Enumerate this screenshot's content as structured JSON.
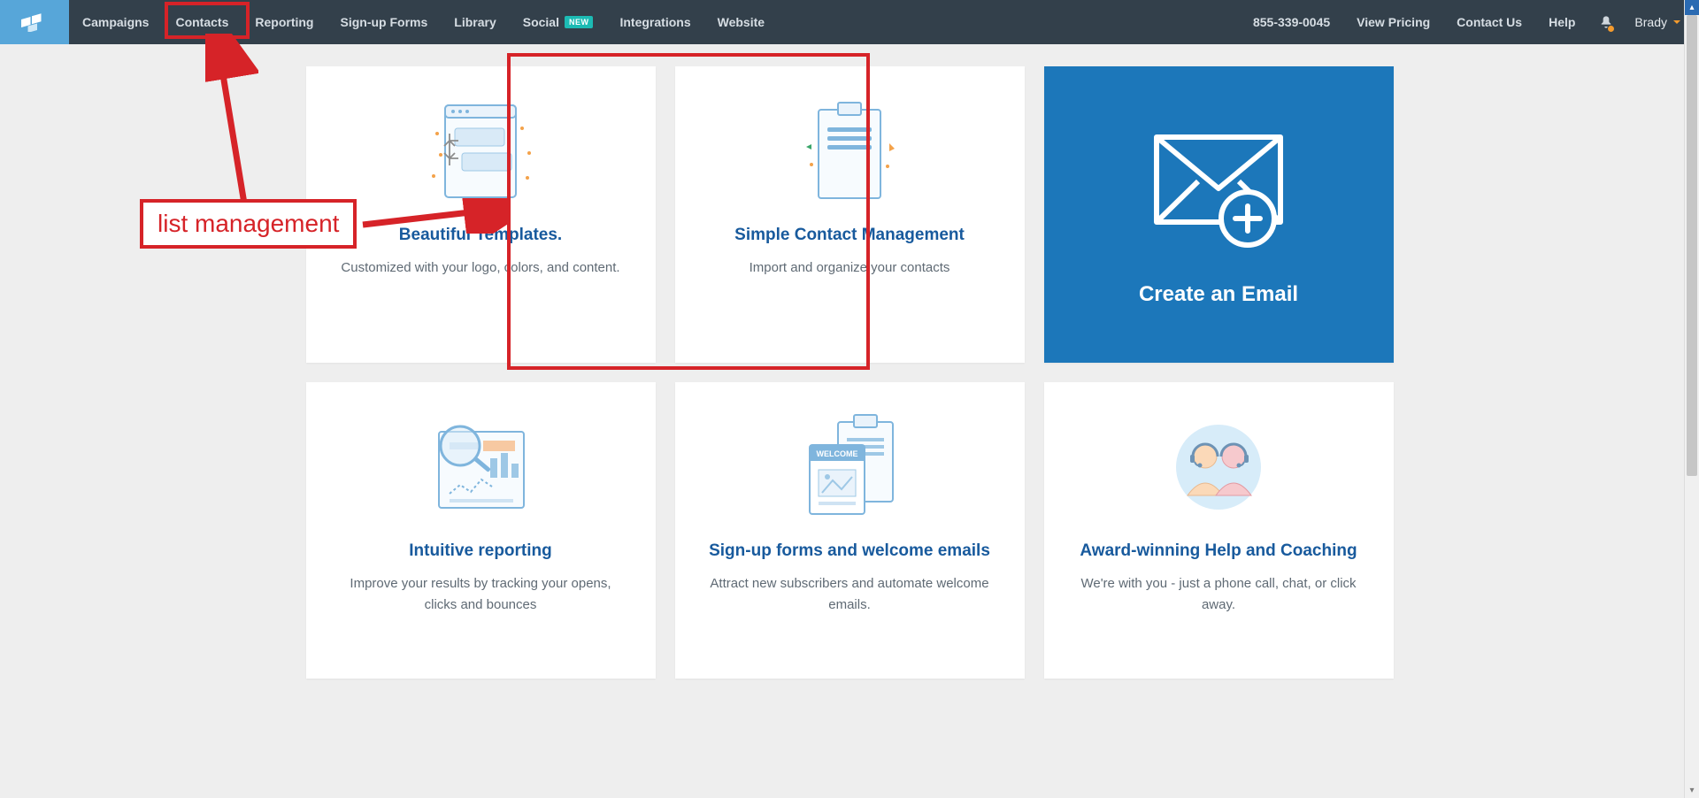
{
  "nav": {
    "left": [
      {
        "label": "Campaigns"
      },
      {
        "label": "Contacts"
      },
      {
        "label": "Reporting"
      },
      {
        "label": "Sign-up Forms"
      },
      {
        "label": "Library"
      },
      {
        "label": "Social",
        "badge": "NEW"
      },
      {
        "label": "Integrations"
      },
      {
        "label": "Website"
      }
    ],
    "right": {
      "phone": "855-339-0045",
      "pricing": "View Pricing",
      "contact": "Contact Us",
      "help": "Help",
      "user": "Brady"
    }
  },
  "cards": {
    "row1": [
      {
        "title": "Beautiful Templates.",
        "desc": "Customized with your logo, colors, and content."
      },
      {
        "title": "Simple Contact Management",
        "desc": "Import and organize your contacts"
      },
      {
        "title": "Create an Email"
      }
    ],
    "row2": [
      {
        "title": "Intuitive reporting",
        "desc": "Improve your results by tracking your opens, clicks and bounces"
      },
      {
        "title": "Sign-up forms and welcome emails",
        "desc": "Attract new subscribers and automate welcome emails."
      },
      {
        "title": "Award-winning Help and Coaching",
        "desc": "We're with you - just a phone call, chat, or click away."
      }
    ]
  },
  "welcome_tag": "WELCOME",
  "annotation_label": "list management"
}
